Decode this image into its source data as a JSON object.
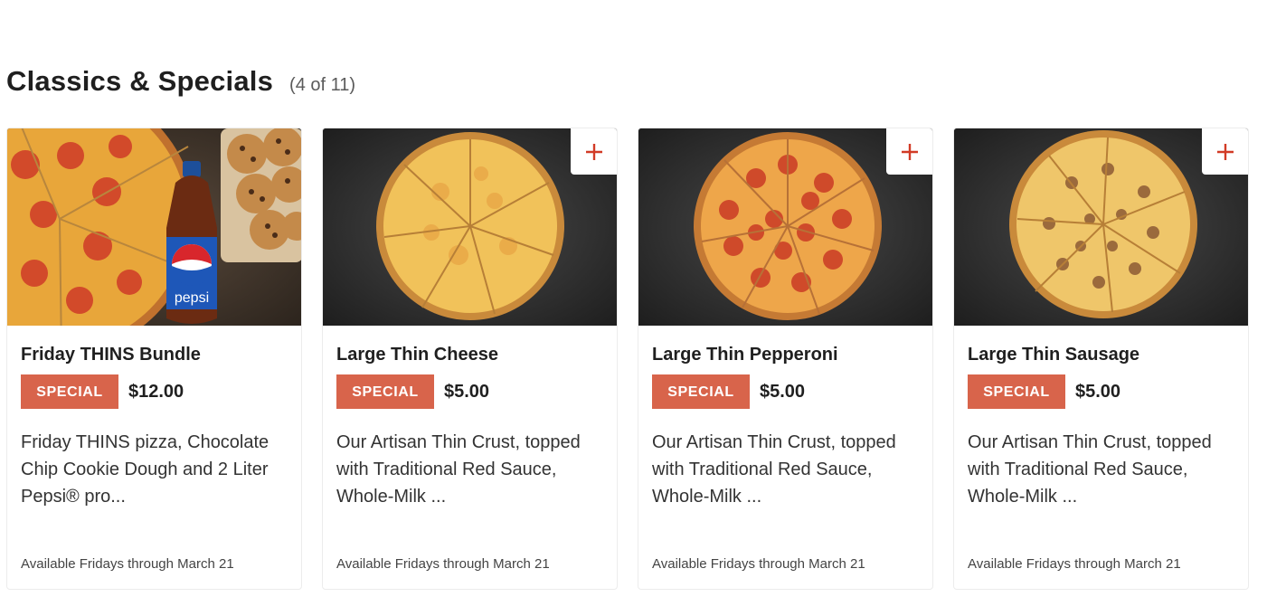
{
  "section": {
    "title": "Classics & Specials",
    "count": "(4 of 11)"
  },
  "colors": {
    "badge": "#d8644b",
    "add_icon": "#d23b26"
  },
  "cards": [
    {
      "title": "Friday THINS Bundle",
      "badge": "SPECIAL",
      "price": "$12.00",
      "description": "Friday THINS pizza, Chocolate Chip Cookie Dough and 2 Liter Pepsi® pro...",
      "availability": "Available Fridays through March 21",
      "image_icon": "pizza-bundle-image",
      "bottle_label": "pepsi"
    },
    {
      "title": "Large Thin Cheese",
      "badge": "SPECIAL",
      "price": "$5.00",
      "description": "Our Artisan Thin Crust, topped with Traditional Red Sauce, Whole-Milk ...",
      "availability": "Available Fridays through March 21",
      "image_icon": "cheese-pizza-image"
    },
    {
      "title": "Large Thin Pepperoni",
      "badge": "SPECIAL",
      "price": "$5.00",
      "description": "Our Artisan Thin Crust, topped with Traditional Red Sauce, Whole-Milk ...",
      "availability": "Available Fridays through March 21",
      "image_icon": "pepperoni-pizza-image"
    },
    {
      "title": "Large Thin Sausage",
      "badge": "SPECIAL",
      "price": "$5.00",
      "description": "Our Artisan Thin Crust, topped with Traditional Red Sauce, Whole-Milk ...",
      "availability": "Available Fridays through March 21",
      "image_icon": "sausage-pizza-image"
    }
  ]
}
